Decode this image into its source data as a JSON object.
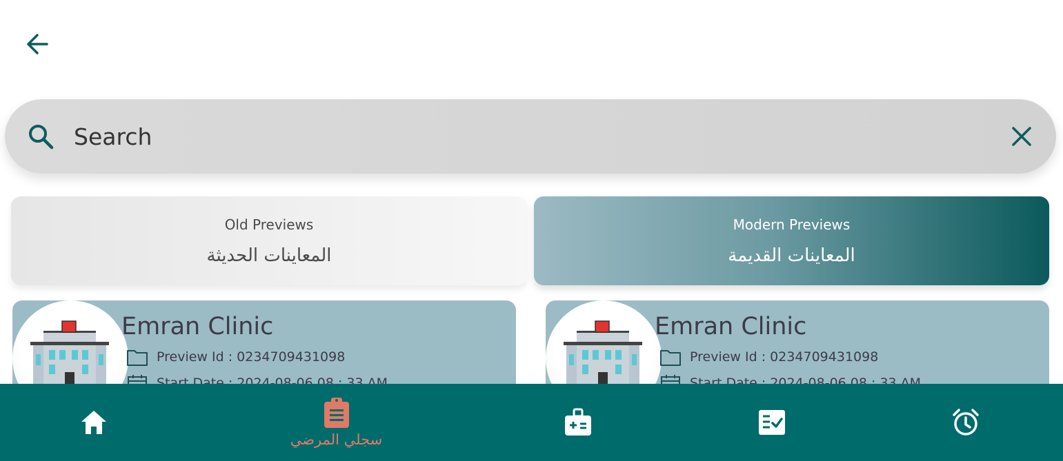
{
  "search": {
    "placeholder": "Search"
  },
  "tabs": [
    {
      "label_en": "Old Previews",
      "label_ar": "المعاينات الحديثة",
      "selected": false
    },
    {
      "label_en": "Modern Previews",
      "label_ar": "المعاينات القديمة",
      "selected": true
    }
  ],
  "cards": [
    {
      "clinic_name": "Emran Clinic",
      "preview_id": "Preview Id : 0234709431098",
      "start_date": "Start Date : 2024-08-06 08 : 33 AM"
    },
    {
      "clinic_name": "Emran Clinic",
      "preview_id": "Preview Id : 0234709431098",
      "start_date": "Start Date : 2024-08-06 08 : 33 AM"
    }
  ],
  "bottom_nav": {
    "active_label": "سجلي المرضي",
    "icons": [
      "home-icon",
      "clipboard-icon",
      "medical-kit-icon",
      "checklist-icon",
      "alarm-icon"
    ]
  },
  "colors": {
    "primary": "#006b6b",
    "accent": "#e07a66",
    "card_bg": "#9bbcc5",
    "icon_teal": "#0d5c5e",
    "text_dark": "#3e3a47"
  }
}
